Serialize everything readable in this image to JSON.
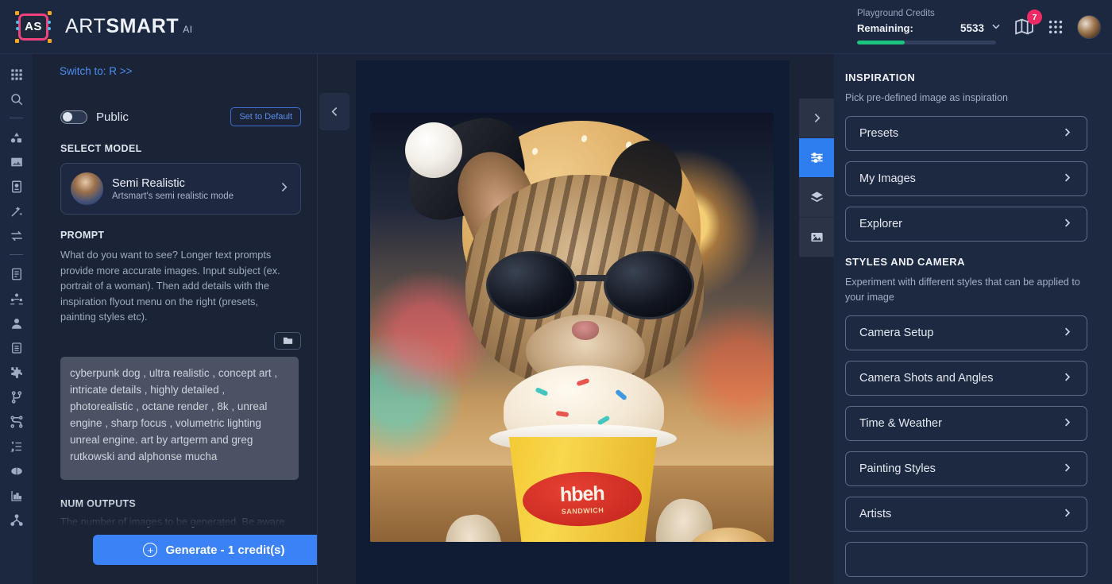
{
  "header": {
    "logo_text": "AS",
    "brand_part1": "ART",
    "brand_part2": "SMART",
    "brand_ai": "AI",
    "credits_title": "Playground Credits",
    "credits_label": "Remaining:",
    "credits_value": "5533",
    "credits_percent": 34,
    "notifications_badge": "7",
    "accent_pink": "#ef2b65",
    "accent_green": "#1dc47d",
    "accent_blue": "#3b82f6"
  },
  "rail": {
    "items": [
      {
        "name": "apps-grid-icon"
      },
      {
        "name": "search-icon"
      },
      {
        "name": "divider"
      },
      {
        "name": "shapes-icon"
      },
      {
        "name": "image-icon"
      },
      {
        "name": "id-card-icon"
      },
      {
        "name": "magic-wand-icon"
      },
      {
        "name": "transfer-arrows-icon"
      },
      {
        "name": "divider"
      },
      {
        "name": "document-icon"
      },
      {
        "name": "group-users-icon"
      },
      {
        "name": "user-icon"
      },
      {
        "name": "list-icon"
      },
      {
        "name": "puzzle-icon"
      },
      {
        "name": "branch-icon"
      },
      {
        "name": "network-icon"
      },
      {
        "name": "ordered-list-icon"
      },
      {
        "name": "brain-icon"
      },
      {
        "name": "chart-icon"
      },
      {
        "name": "share-nodes-icon"
      }
    ]
  },
  "left_panel": {
    "switch_link": "Switch to: R >>",
    "toggle_label": "Public",
    "toggle_on": false,
    "default_button": "Set to Default",
    "select_model_label": "SELECT MODEL",
    "model_title": "Semi Realistic",
    "model_subtitle": "Artsmart's semi realistic mode",
    "prompt_label": "PROMPT",
    "prompt_description": "What do you want to see? Longer text prompts provide more accurate images. Input subject (ex. portrait of a woman). Then add details with the inspiration flyout menu on the right (presets, painting styles etc).",
    "prompt_value": "cyberpunk dog , ultra realistic , concept art , intricate details , highly detailed , photorealistic , octane render , 8k , unreal engine , sharp focus , volumetric lighting unreal engine. art by artgerm and greg rutkowski and alphonse mucha",
    "num_outputs_label": "NUM OUTPUTS",
    "num_outputs_description": "The number of images to be generated. Be aware",
    "generate_button": "Generate - 1 credit(s)"
  },
  "canvas": {
    "collapse_icon": "chevron-left-icon",
    "artwork_alt": "Tabby cat wearing sunglasses and a santa hat holding a yellow ice cream cup",
    "cup_logo_line1": "hbeh",
    "cup_logo_line2": "SANDWICH"
  },
  "tool_strip": {
    "buttons": [
      {
        "name": "expand-panel-button",
        "icon": "chevron-right-icon",
        "active": false
      },
      {
        "name": "settings-sliders-button",
        "icon": "sliders-icon",
        "active": true
      },
      {
        "name": "layers-button",
        "icon": "layers-icon",
        "active": false
      },
      {
        "name": "gallery-button",
        "icon": "image-icon",
        "active": false
      }
    ]
  },
  "right_panel": {
    "inspiration_title": "INSPIRATION",
    "inspiration_subtitle": "Pick pre-defined image as inspiration",
    "inspiration_items": [
      {
        "label": "Presets"
      },
      {
        "label": "My Images"
      },
      {
        "label": "Explorer"
      }
    ],
    "styles_title": "STYLES AND CAMERA",
    "styles_subtitle": "Experiment with different styles that can be applied to your image",
    "styles_items": [
      {
        "label": "Camera Setup"
      },
      {
        "label": "Camera Shots and Angles"
      },
      {
        "label": "Time & Weather"
      },
      {
        "label": "Painting Styles"
      },
      {
        "label": "Artists"
      }
    ]
  }
}
